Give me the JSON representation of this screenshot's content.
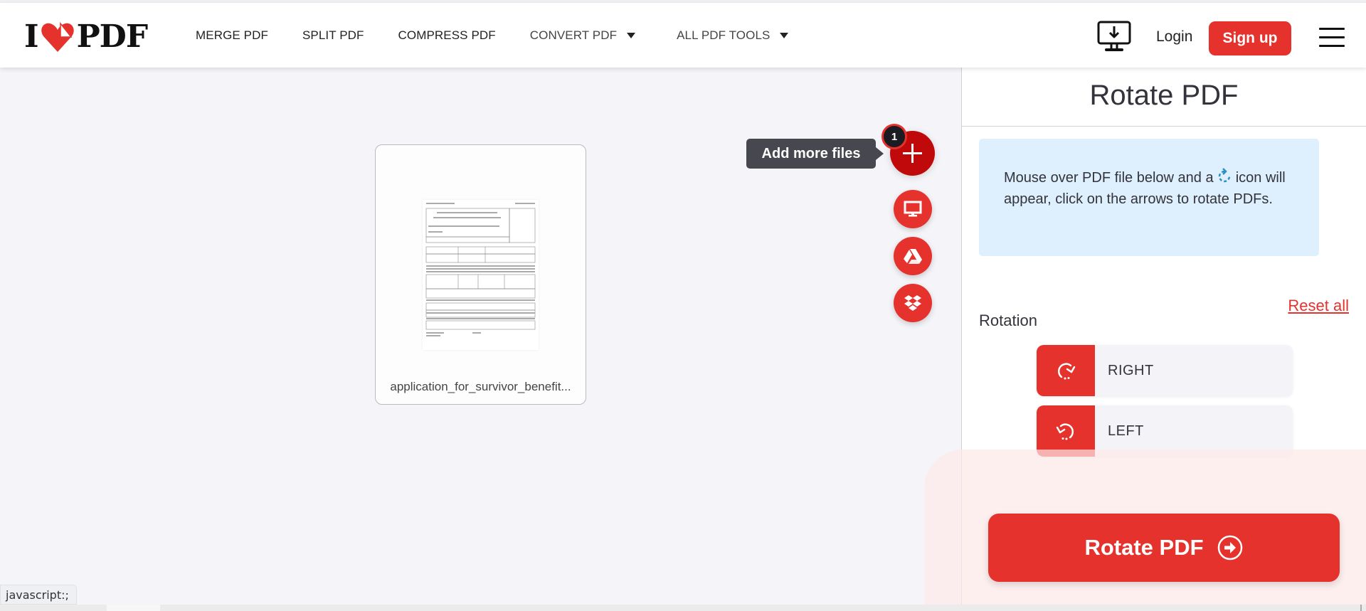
{
  "header": {
    "logo": {
      "left": "I",
      "right": "PDF",
      "heart_icon": "heart-pdf-icon"
    },
    "nav": [
      {
        "label": "MERGE PDF",
        "dropdown": false
      },
      {
        "label": "SPLIT PDF",
        "dropdown": false
      },
      {
        "label": "COMPRESS PDF",
        "dropdown": false
      },
      {
        "label": "CONVERT PDF",
        "dropdown": true
      },
      {
        "label": "ALL PDF TOOLS",
        "dropdown": true
      }
    ],
    "desktop_icon": "desktop-download-icon",
    "login_label": "Login",
    "signup_label": "Sign up"
  },
  "main": {
    "file": {
      "name": "application_for_survivor_benefit..."
    },
    "upload": {
      "tooltip": "Add more files",
      "file_count": "1",
      "sources": [
        {
          "name": "computer",
          "icon": "monitor-icon"
        },
        {
          "name": "google-drive",
          "icon": "google-drive-icon"
        },
        {
          "name": "dropbox",
          "icon": "dropbox-icon"
        }
      ]
    }
  },
  "sidebar": {
    "title": "Rotate PDF",
    "info_before": "Mouse over PDF file below and a",
    "info_after": "icon will appear, click on the arrows to rotate PDFs.",
    "rotation_label": "Rotation",
    "reset_label": "Reset all",
    "buttons": [
      {
        "label": "RIGHT",
        "icon": "rotate-right-icon"
      },
      {
        "label": "LEFT",
        "icon": "rotate-left-icon"
      }
    ],
    "cta_label": "Rotate PDF"
  },
  "status_bar": {
    "url": "javascript:;"
  },
  "colors": {
    "brand_red": "#e5322d",
    "fab_dark_red": "#c0090a",
    "info_bg": "#def0fd",
    "page_bg": "#f4f4f9",
    "tooltip_bg": "#47474f"
  }
}
